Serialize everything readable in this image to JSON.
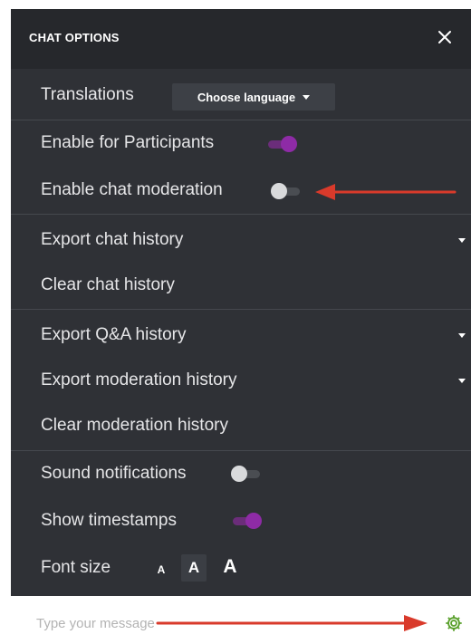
{
  "header": {
    "title": "CHAT OPTIONS",
    "close_label": "×"
  },
  "translations": {
    "label": "Translations",
    "select_value": "Choose language"
  },
  "moderation": {
    "enable_participants_label": "Enable for Participants",
    "enable_participants_on": true,
    "enable_moderation_label": "Enable chat moderation",
    "enable_moderation_on": false
  },
  "chat_history": {
    "export_label": "Export chat history",
    "clear_label": "Clear chat history"
  },
  "qa_history": {
    "export_qa_label": "Export Q&A history",
    "export_moderation_label": "Export moderation history",
    "clear_moderation_label": "Clear moderation history"
  },
  "preferences": {
    "sound_label": "Sound notifications",
    "sound_on": false,
    "timestamps_label": "Show timestamps",
    "timestamps_on": true,
    "font_size_label": "Font size",
    "font_sizes": [
      "A",
      "A",
      "A"
    ],
    "font_size_selected_index": 1
  },
  "composer": {
    "placeholder": "Type your message"
  },
  "icons": {
    "close": "close-icon",
    "settings": "gear-icon",
    "dropdown": "chevron-down-icon"
  },
  "colors": {
    "panel_bg": "#2f3136",
    "header_bg": "#26282c",
    "toggle_on": "#8e2ba6",
    "annotation_arrow": "#d93a2b",
    "settings_icon": "#5aa02c"
  }
}
